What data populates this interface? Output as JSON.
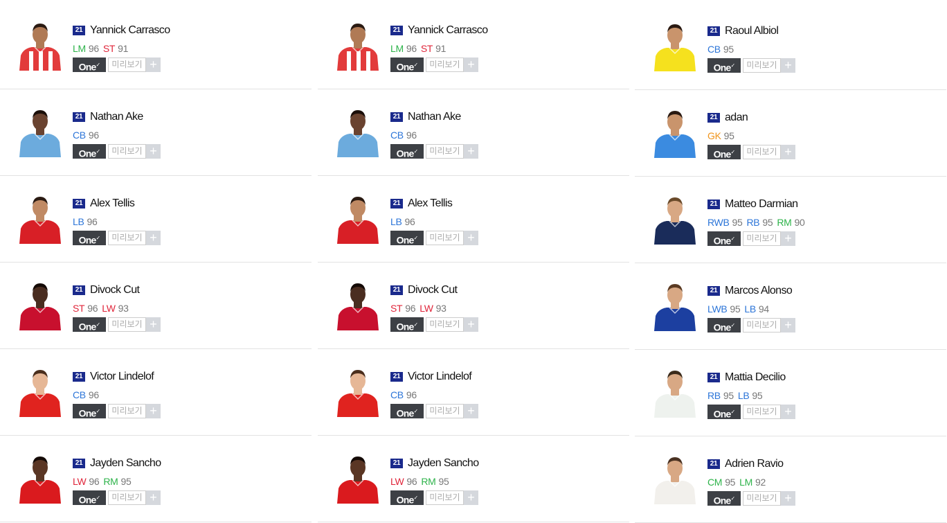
{
  "columns": [
    {
      "cards": [
        {
          "season": "21",
          "name": "Yannick Carrasco",
          "positions": [
            {
              "pos": "LM",
              "ovr": "96",
              "color": "green"
            },
            {
              "pos": "ST",
              "ovr": "91",
              "color": "red"
            }
          ],
          "kit": {
            "shirt": "#e23b3b",
            "stripe": "#ffffff",
            "skin": "#b07a55",
            "hair": "#2a1a12"
          }
        },
        {
          "season": "21",
          "name": "Nathan Ake",
          "positions": [
            {
              "pos": "CB",
              "ovr": "96",
              "color": "blue"
            }
          ],
          "kit": {
            "shirt": "#6cabdd",
            "stripe": "#6cabdd",
            "skin": "#6a4330",
            "hair": "#1b0f0a"
          }
        },
        {
          "season": "21",
          "name": "Alex Tellis",
          "positions": [
            {
              "pos": "LB",
              "ovr": "96",
              "color": "blue"
            }
          ],
          "kit": {
            "shirt": "#d81f26",
            "stripe": "#d81f26",
            "skin": "#c08a64",
            "hair": "#2a1a12"
          }
        },
        {
          "season": "21",
          "name": "Divock Cut",
          "positions": [
            {
              "pos": "ST",
              "ovr": "96",
              "color": "red"
            },
            {
              "pos": "LW",
              "ovr": "93",
              "color": "red"
            }
          ],
          "kit": {
            "shirt": "#c8102e",
            "stripe": "#c8102e",
            "skin": "#4a2d20",
            "hair": "#140a06"
          }
        },
        {
          "season": "21",
          "name": "Victor Lindelof",
          "positions": [
            {
              "pos": "CB",
              "ovr": "96",
              "color": "blue"
            }
          ],
          "kit": {
            "shirt": "#e0231f",
            "stripe": "#e0231f",
            "skin": "#e6b796",
            "hair": "#4a2e1c"
          }
        },
        {
          "season": "21",
          "name": "Jayden Sancho",
          "positions": [
            {
              "pos": "LW",
              "ovr": "96",
              "color": "red"
            },
            {
              "pos": "RM",
              "ovr": "95",
              "color": "green"
            }
          ],
          "kit": {
            "shirt": "#da1a1e",
            "stripe": "#da1a1e",
            "skin": "#5a3624",
            "hair": "#140a06"
          }
        }
      ]
    },
    {
      "cards": [
        {
          "season": "21",
          "name": "Yannick Carrasco",
          "positions": [
            {
              "pos": "LM",
              "ovr": "96",
              "color": "green"
            },
            {
              "pos": "ST",
              "ovr": "91",
              "color": "red"
            }
          ],
          "kit": {
            "shirt": "#e23b3b",
            "stripe": "#ffffff",
            "skin": "#b07a55",
            "hair": "#2a1a12"
          }
        },
        {
          "season": "21",
          "name": "Nathan Ake",
          "positions": [
            {
              "pos": "CB",
              "ovr": "96",
              "color": "blue"
            }
          ],
          "kit": {
            "shirt": "#6cabdd",
            "stripe": "#6cabdd",
            "skin": "#6a4330",
            "hair": "#1b0f0a"
          }
        },
        {
          "season": "21",
          "name": "Alex Tellis",
          "positions": [
            {
              "pos": "LB",
              "ovr": "96",
              "color": "blue"
            }
          ],
          "kit": {
            "shirt": "#d81f26",
            "stripe": "#d81f26",
            "skin": "#c08a64",
            "hair": "#2a1a12"
          }
        },
        {
          "season": "21",
          "name": "Divock Cut",
          "positions": [
            {
              "pos": "ST",
              "ovr": "96",
              "color": "red"
            },
            {
              "pos": "LW",
              "ovr": "93",
              "color": "red"
            }
          ],
          "kit": {
            "shirt": "#c8102e",
            "stripe": "#c8102e",
            "skin": "#4a2d20",
            "hair": "#140a06"
          }
        },
        {
          "season": "21",
          "name": "Victor Lindelof",
          "positions": [
            {
              "pos": "CB",
              "ovr": "96",
              "color": "blue"
            }
          ],
          "kit": {
            "shirt": "#e0231f",
            "stripe": "#e0231f",
            "skin": "#e6b796",
            "hair": "#4a2e1c"
          }
        },
        {
          "season": "21",
          "name": "Jayden Sancho",
          "positions": [
            {
              "pos": "LW",
              "ovr": "96",
              "color": "red"
            },
            {
              "pos": "RM",
              "ovr": "95",
              "color": "green"
            }
          ],
          "kit": {
            "shirt": "#da1a1e",
            "stripe": "#da1a1e",
            "skin": "#5a3624",
            "hair": "#140a06"
          }
        }
      ]
    },
    {
      "cards": [
        {
          "season": "21",
          "name": "Raoul Albiol",
          "positions": [
            {
              "pos": "CB",
              "ovr": "95",
              "color": "blue"
            }
          ],
          "kit": {
            "shirt": "#f5e11e",
            "stripe": "#f5e11e",
            "skin": "#c9946c",
            "hair": "#2a1a12"
          }
        },
        {
          "season": "21",
          "name": "adan",
          "positions": [
            {
              "pos": "GK",
              "ovr": "95",
              "color": "orange"
            }
          ],
          "kit": {
            "shirt": "#3b8be0",
            "stripe": "#3b8be0",
            "skin": "#c9946c",
            "hair": "#2a1a12"
          }
        },
        {
          "season": "21",
          "name": "Matteo Darmian",
          "positions": [
            {
              "pos": "RWB",
              "ovr": "95",
              "color": "blue"
            },
            {
              "pos": "RB",
              "ovr": "95",
              "color": "blue"
            },
            {
              "pos": "RM",
              "ovr": "90",
              "color": "green"
            }
          ],
          "kit": {
            "shirt": "#1a2c5a",
            "stripe": "#1a2c5a",
            "skin": "#d8a884",
            "hair": "#6a4a2a"
          }
        },
        {
          "season": "21",
          "name": "Marcos Alonso",
          "positions": [
            {
              "pos": "LWB",
              "ovr": "95",
              "color": "blue"
            },
            {
              "pos": "LB",
              "ovr": "94",
              "color": "blue"
            }
          ],
          "kit": {
            "shirt": "#1c3fa0",
            "stripe": "#1c3fa0",
            "skin": "#d8a884",
            "hair": "#5a3a22"
          }
        },
        {
          "season": "21",
          "name": "Mattia Decilio",
          "positions": [
            {
              "pos": "RB",
              "ovr": "95",
              "color": "blue"
            },
            {
              "pos": "LB",
              "ovr": "95",
              "color": "blue"
            }
          ],
          "kit": {
            "shirt": "#eef2ee",
            "stripe": "#eef2ee",
            "skin": "#d8a884",
            "hair": "#3a2a1a"
          }
        },
        {
          "season": "21",
          "name": "Adrien Ravio",
          "positions": [
            {
              "pos": "CM",
              "ovr": "95",
              "color": "green"
            },
            {
              "pos": "LM",
              "ovr": "92",
              "color": "green"
            }
          ],
          "kit": {
            "shirt": "#f2f0ec",
            "stripe": "#f2f0ec",
            "skin": "#d8a884",
            "hair": "#4a3222"
          }
        }
      ]
    }
  ],
  "one_label": "One",
  "preview_label": "미리보기",
  "plus_label": "+",
  "colors": {
    "green": "#2db34a",
    "red": "#e0253a",
    "blue": "#2c75d8",
    "orange": "#f0941a",
    "season_badge": "#1a2a8c"
  }
}
